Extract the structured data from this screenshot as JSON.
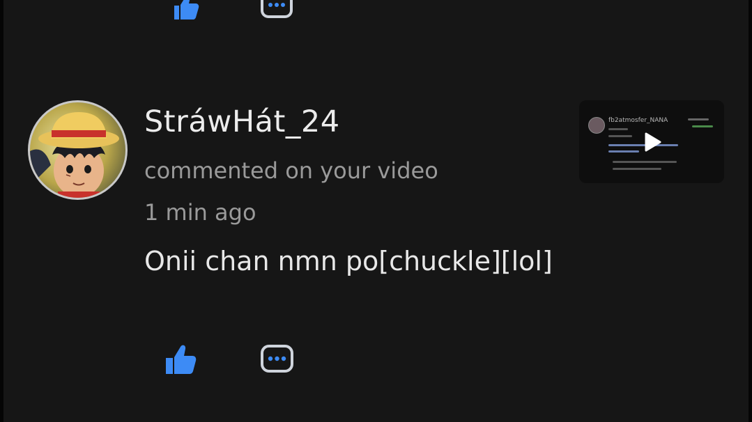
{
  "notification": {
    "username": "StráwHát_24",
    "action": "commented on your video",
    "time": "1 min ago",
    "comment": "Onii chan nmn po[chuckle][lol]"
  },
  "thumbnail": {
    "caption": "fb2atmosfer_NANA"
  },
  "icons": {
    "like": "thumbs-up-icon",
    "reply": "comment-bubble-icon",
    "play": "play-icon"
  },
  "colors": {
    "accent": "#3d8bf5",
    "background": "#161616",
    "primary_text": "#ececec",
    "secondary_text": "#9a9a9a"
  }
}
